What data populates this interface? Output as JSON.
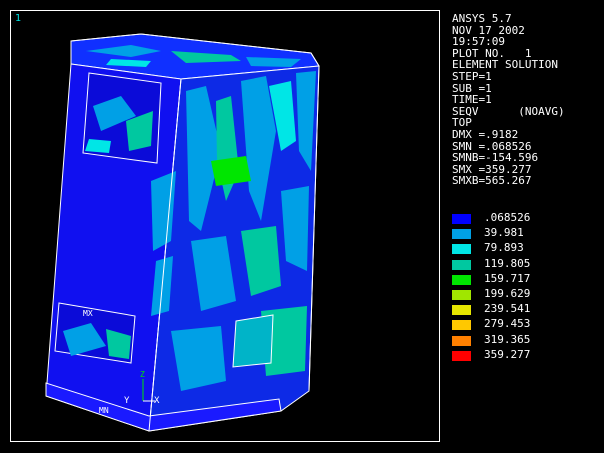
{
  "viewport": {
    "window_number": "1"
  },
  "info_lines": [
    "ANSYS 5.7",
    "NOV 17 2002",
    "19:57:09",
    "PLOT NO.   1",
    "ELEMENT SOLUTION",
    "STEP=1",
    "SUB =1",
    "TIME=1",
    "SEQV      (NOAVG)",
    "TOP",
    "DMX =.9182",
    "SMN =.068526",
    "SMNB=-154.596",
    "SMX =359.277",
    "SMXB=565.267"
  ],
  "legend": [
    {
      "value": ".068526",
      "color": "#0000ff"
    },
    {
      "value": "39.981",
      "color": "#00a0e6"
    },
    {
      "value": "79.893",
      "color": "#00e6e6"
    },
    {
      "value": "119.805",
      "color": "#00c8a0"
    },
    {
      "value": "159.717",
      "color": "#00e600"
    },
    {
      "value": "199.629",
      "color": "#a0e600"
    },
    {
      "value": "239.541",
      "color": "#e6e600"
    },
    {
      "value": "279.453",
      "color": "#ffc800"
    },
    {
      "value": "319.365",
      "color": "#ff8000"
    },
    {
      "value": "359.277",
      "color": "#ff0000"
    }
  ],
  "model_labels": {
    "mx": "MX",
    "mn": "MN",
    "axis_y": "Y",
    "axis_z": "Z",
    "axis_x": "X"
  }
}
